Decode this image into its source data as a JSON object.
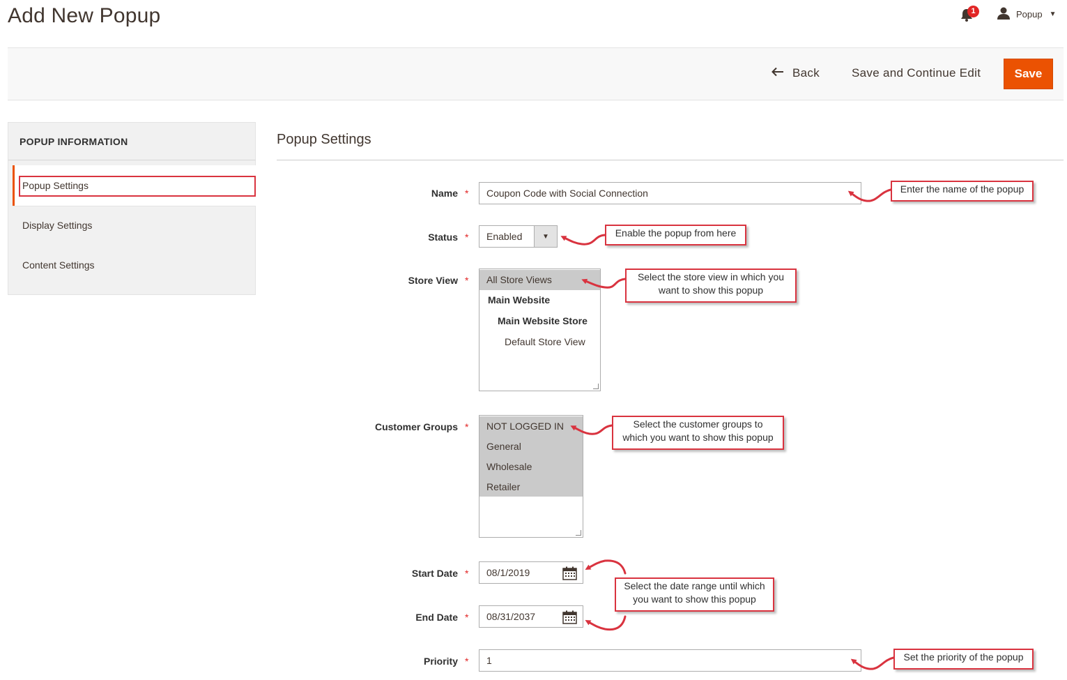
{
  "header": {
    "title": "Add New Popup",
    "notification_count": "1",
    "user_name": "Popup"
  },
  "actions": {
    "back_label": "Back",
    "save_continue_label": "Save and Continue Edit",
    "save_label": "Save"
  },
  "sidebar": {
    "heading": "POPUP INFORMATION",
    "items": [
      {
        "label": "Popup Settings",
        "active": true
      },
      {
        "label": "Display Settings",
        "active": false
      },
      {
        "label": "Content Settings",
        "active": false
      }
    ]
  },
  "section": {
    "title": "Popup Settings"
  },
  "form": {
    "required_mark": "*",
    "name": {
      "label": "Name",
      "value": "Coupon Code with Social Connection"
    },
    "status": {
      "label": "Status",
      "value": "Enabled"
    },
    "store_view": {
      "label": "Store View",
      "options": [
        "All Store Views",
        "Main Website",
        "Main Website Store",
        "Default Store View"
      ],
      "selected": "All Store Views"
    },
    "customer_groups": {
      "label": "Customer Groups",
      "options": [
        "NOT LOGGED IN",
        "General",
        "Wholesale",
        "Retailer"
      ],
      "selected": [
        "NOT LOGGED IN",
        "General",
        "Wholesale",
        "Retailer"
      ]
    },
    "start_date": {
      "label": "Start Date",
      "value": "08/1/2019"
    },
    "end_date": {
      "label": "End Date",
      "value": "08/31/2037"
    },
    "priority": {
      "label": "Priority",
      "value": "1"
    }
  },
  "callouts": {
    "name": "Enter the name of the popup",
    "status": "Enable the popup from here",
    "store_view_line1": "Select the store view in which you",
    "store_view_line2": "want to show this popup",
    "customer_groups_line1": "Select the customer groups to",
    "customer_groups_line2": "which you want to show this popup",
    "dates_line1": "Select the date range until which",
    "dates_line2": "you want to show this popup",
    "priority": "Set the priority of the popup"
  },
  "colors": {
    "accent": "#eb5202",
    "annotation": "#d9333f",
    "badge": "#e22626"
  }
}
